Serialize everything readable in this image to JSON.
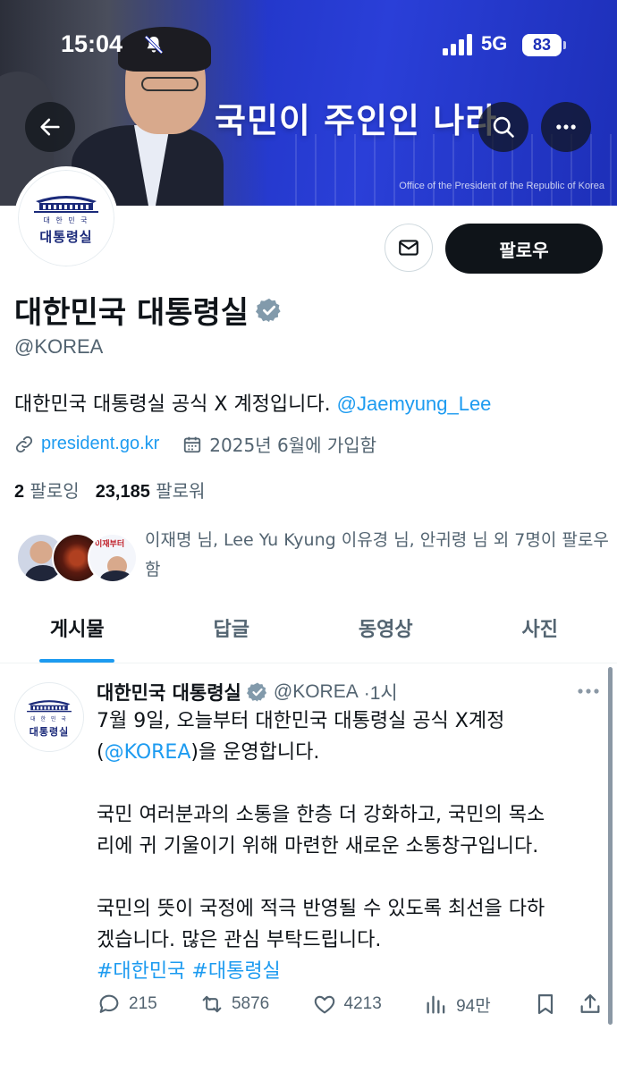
{
  "status_bar": {
    "time": "15:04",
    "network": "5G",
    "battery": "83"
  },
  "banner": {
    "title": "국민이 주인인 나라",
    "caption": "Office of the President of the Republic of Korea"
  },
  "avatar_logo": {
    "small": "대 한 민 국",
    "big": "대통령실"
  },
  "profile": {
    "name": "대한민국 대통령실",
    "handle": "@KOREA",
    "bio_text": "대한민국 대통령실 공식 X 계정입니다. ",
    "bio_mention": "@Jaemyung_Lee",
    "website": "president.go.kr",
    "joined": "2025년 6월에 가입함",
    "following_count": "2",
    "following_label": "팔로잉",
    "followers_count": "23,185",
    "followers_label": "팔로워",
    "known_followers": "이재명 님, Lee Yu Kyung 이유경 님, 안귀령 님 외 7명이 팔로우함",
    "follow_button": "팔로우",
    "mini_avatar_text": "이재부터"
  },
  "tabs": [
    {
      "label": "게시물",
      "active": true
    },
    {
      "label": "답글",
      "active": false
    },
    {
      "label": "동영상",
      "active": false
    },
    {
      "label": "사진",
      "active": false
    }
  ],
  "post": {
    "name": "대한민국 대통령실",
    "handle": "@KOREA",
    "time": "·1시",
    "line1": "7월 9일, 오늘부터 대한민국 대통령실 공식 X계정",
    "line2_open": "(",
    "line2_mention": "@KOREA",
    "line2_rest": ")을 운영합니다.",
    "para2_line1": "국민 여러분과의 소통을 한층 더 강화하고, 국민의 목소",
    "para2_line2": "리에 귀 기울이기 위해 마련한 새로운 소통창구입니다.",
    "para3_line1": "국민의 뜻이 국정에 적극 반영될 수 있도록 최선을 다하",
    "para3_line2": "겠습니다. 많은 관심 부탁드립니다.",
    "hashtag1": "#대한민국",
    "hashtag2": "#대통령실",
    "replies": "215",
    "reposts": "5876",
    "likes": "4213",
    "views": "94만"
  },
  "colors": {
    "accent": "#1d9bf0",
    "banner": "#2236c8",
    "text": "#0f1419",
    "muted": "#536471"
  }
}
